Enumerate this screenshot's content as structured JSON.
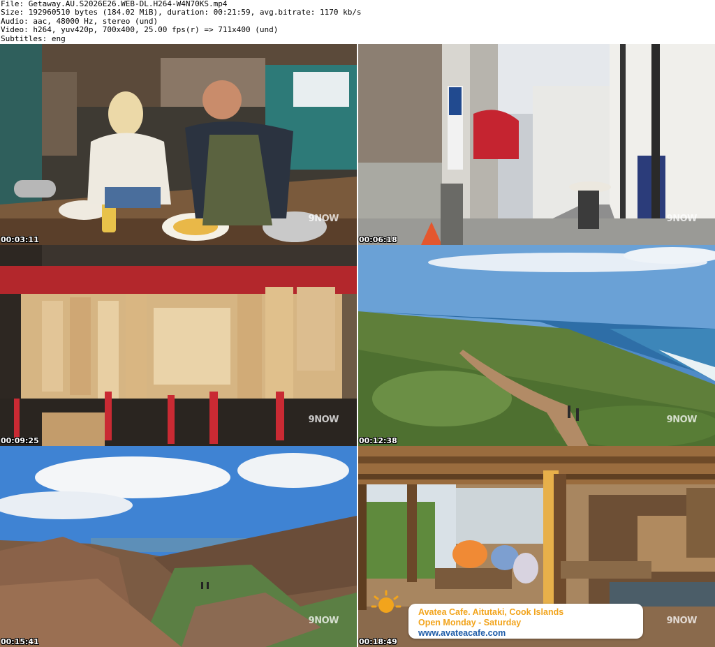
{
  "header": {
    "file": "File: Getaway.AU.S2026E26.WEB-DL.H264-W4N70KS.mp4",
    "size": "Size: 192960510 bytes (184.02 MiB), duration: 00:21:59, avg.bitrate: 1170 kb/s",
    "audio": "Audio: aac, 48000 Hz, stereo (und)",
    "video": "Video: h264, yuv420p, 700x400, 25.00 fps(r) => 711x400 (und)",
    "subtitles": "Subtitles: eng"
  },
  "thumbnails": [
    {
      "timestamp": "00:03:11",
      "logo": "9NOW",
      "scene": "kitchen"
    },
    {
      "timestamp": "00:06:18",
      "logo": "9NOW",
      "scene": "street"
    },
    {
      "timestamp": "00:09:25",
      "logo": "9NOW",
      "scene": "ema-plaques"
    },
    {
      "timestamp": "00:12:38",
      "logo": "9NOW",
      "scene": "coastal-trail"
    },
    {
      "timestamp": "00:15:41",
      "logo": "9NOW",
      "scene": "rocky-gorge"
    },
    {
      "timestamp": "00:18:49",
      "logo": "9NOW",
      "scene": "cafe-terrace"
    }
  ],
  "lower_third": {
    "line1": "Avatea Cafe. Aitutaki, Cook Islands",
    "line2": "Open Monday - Saturday",
    "line3": "www.avateacafe.com"
  },
  "colors": {
    "caption_orange": "#f2a41c",
    "caption_blue": "#1f5ca8"
  }
}
